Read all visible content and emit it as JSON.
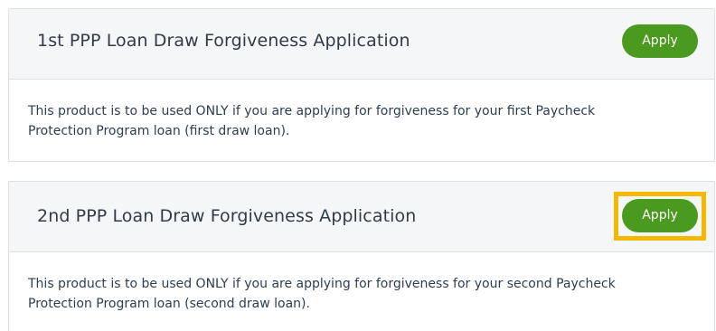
{
  "cards": [
    {
      "title": "1st PPP Loan Draw Forgiveness Application",
      "button_label": "Apply",
      "description": "This product is to be used ONLY if you are applying for forgiveness for your first Paycheck Protection Program loan (first draw loan)."
    },
    {
      "title": "2nd PPP Loan Draw Forgiveness Application",
      "button_label": "Apply",
      "description": "This product is to be used ONLY if you are applying for forgiveness for your second Paycheck Protection Program loan (second draw loan).",
      "highlighted": true
    }
  ],
  "colors": {
    "button": "#4a9a1f",
    "highlight": "#f5b800",
    "header_bg": "#f5f6f8"
  }
}
